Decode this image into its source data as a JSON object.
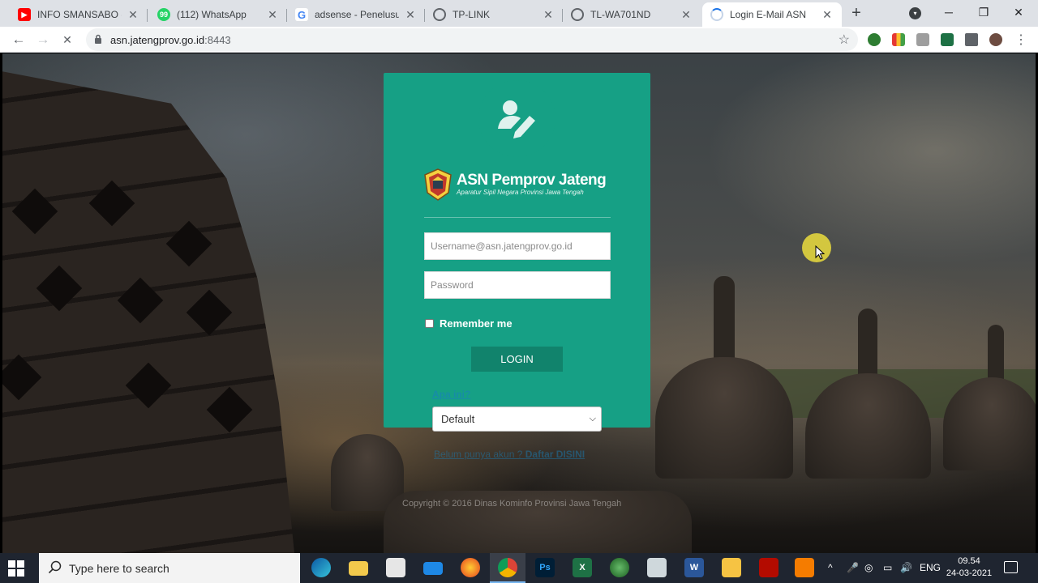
{
  "browser": {
    "tabs": [
      {
        "title": "INFO SMANSABO - Yo",
        "favicon": "youtube-icon",
        "color": "#ff0000"
      },
      {
        "title": "(112) WhatsApp",
        "favicon": "whatsapp-icon",
        "color": "#25d366",
        "badge": "99+"
      },
      {
        "title": "adsense - Penelusuran",
        "favicon": "google-icon",
        "color": "#4285f4"
      },
      {
        "title": "TP-LINK",
        "favicon": "globe-icon",
        "color": "#5f6368"
      },
      {
        "title": "TL-WA701ND",
        "favicon": "globe-icon",
        "color": "#5f6368"
      },
      {
        "title": "Login E-Mail ASN",
        "favicon": "loading-icon",
        "color": "#1a73e8",
        "active": true
      }
    ],
    "url_host": "asn.jatengprov.go.id",
    "url_port": ":8443"
  },
  "login": {
    "brand_title": "ASN Pemprov Jateng",
    "brand_subtitle": "Aparatur Sipil Negara Provinsi Jawa Tengah",
    "username_placeholder": "Username@asn.jatengprov.go.id",
    "password_placeholder": "Password",
    "remember_label": "Remember me",
    "login_button": "LOGIN",
    "what_is_it": "Apa ini?",
    "skin_selected": "Default",
    "register_text": "Belum punya akun ? ",
    "register_link": "Daftar DISINI",
    "copyright": "Copyright © 2016 Dinas Kominfo Provinsi Jawa Tengah",
    "accent_color": "#16a085"
  },
  "taskbar": {
    "search_placeholder": "Type here to search",
    "language": "ENG",
    "time": "09.54",
    "date": "24-03-2021"
  }
}
